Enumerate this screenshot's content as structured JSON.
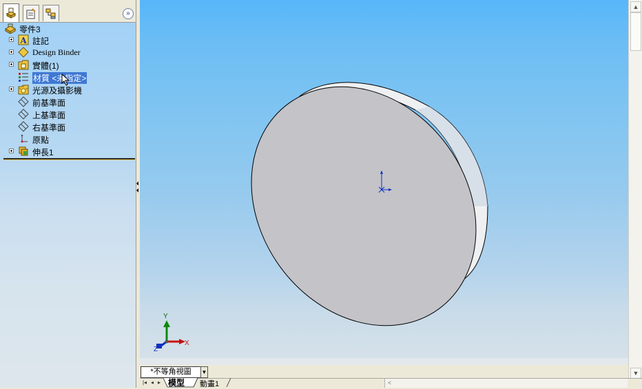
{
  "feature_tree": {
    "root_label": "零件3",
    "items": [
      {
        "label": "註記",
        "icon": "annotations-icon",
        "expandable": true
      },
      {
        "label": "Design Binder",
        "icon": "design-binder-icon",
        "expandable": true
      },
      {
        "label": "實體(1)",
        "icon": "solid-bodies-icon",
        "expandable": true
      },
      {
        "label": "材質 <未指定>",
        "icon": "material-icon",
        "expandable": false,
        "selected": true
      },
      {
        "label": "光源及攝影機",
        "icon": "lights-cameras-icon",
        "expandable": true
      },
      {
        "label": "前基準面",
        "icon": "plane-icon",
        "expandable": false
      },
      {
        "label": "上基準面",
        "icon": "plane-icon",
        "expandable": false
      },
      {
        "label": "右基準面",
        "icon": "plane-icon",
        "expandable": false
      },
      {
        "label": "原點",
        "icon": "origin-icon",
        "expandable": false
      },
      {
        "label": "伸長1",
        "icon": "extrude-icon",
        "expandable": true
      }
    ]
  },
  "panel_tabs": [
    "feature-manager-tab",
    "property-manager-tab",
    "configuration-manager-tab"
  ],
  "viewport": {
    "view_name": "*不等角視圖",
    "triad": {
      "x": "X",
      "y": "Y",
      "z": "Z"
    },
    "colors": {
      "x": "#d01010",
      "y": "#0a8a0a",
      "z": "#1030c0"
    }
  },
  "bottom_tabs": {
    "model": "模型",
    "animation": "動畫1"
  },
  "colors": {
    "selection": "#3f78d4",
    "part_face": "#c3c3c8",
    "part_side": "#eef0f2"
  }
}
